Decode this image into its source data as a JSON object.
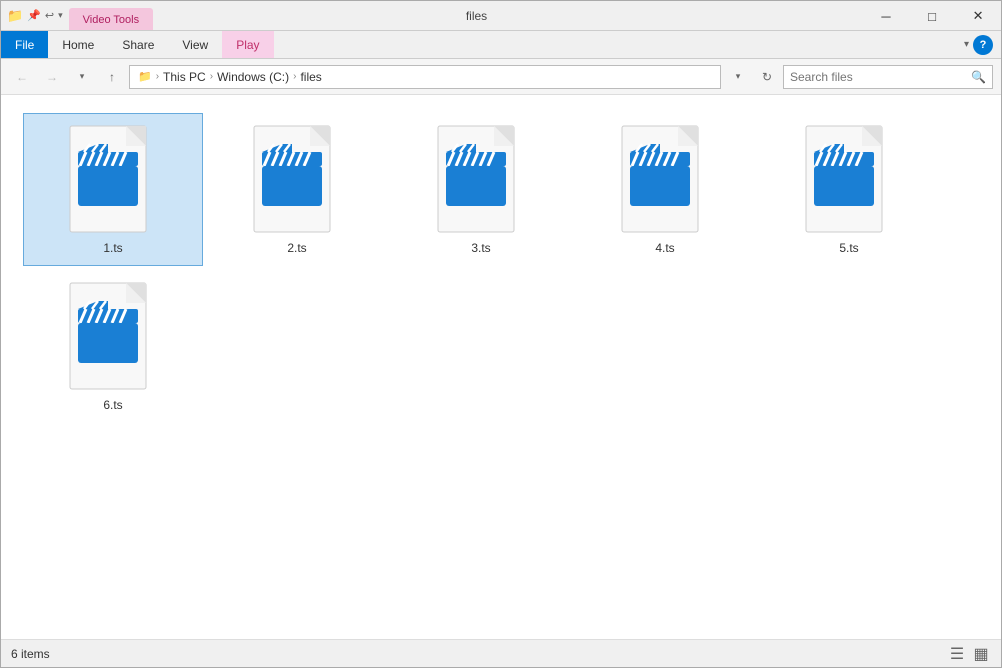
{
  "window": {
    "title": "files",
    "titlebar_tab_video_tools": "Video Tools",
    "window_btn_minimize": "─",
    "window_btn_maximize": "□",
    "window_btn_close": "✕"
  },
  "ribbon": {
    "tab_file": "File",
    "tab_home": "Home",
    "tab_share": "Share",
    "tab_view": "View",
    "tab_play": "Play"
  },
  "addressbar": {
    "this_pc": "This PC",
    "windows_c": "Windows (C:)",
    "folder": "files",
    "search_placeholder": "Search files",
    "refresh_icon": "↻"
  },
  "files": [
    {
      "name": "1.ts",
      "selected": true
    },
    {
      "name": "2.ts",
      "selected": false
    },
    {
      "name": "3.ts",
      "selected": false
    },
    {
      "name": "4.ts",
      "selected": false
    },
    {
      "name": "5.ts",
      "selected": false
    },
    {
      "name": "6.ts",
      "selected": false
    }
  ],
  "statusbar": {
    "item_count": "6 items",
    "view_list_icon": "☰",
    "view_grid_icon": "▦"
  },
  "icons": {
    "back": "←",
    "forward": "→",
    "up": "↑",
    "chevron": "›",
    "dropdown": "▾",
    "search": "🔍",
    "quick_access_pin": "📌",
    "folder": "📁"
  }
}
